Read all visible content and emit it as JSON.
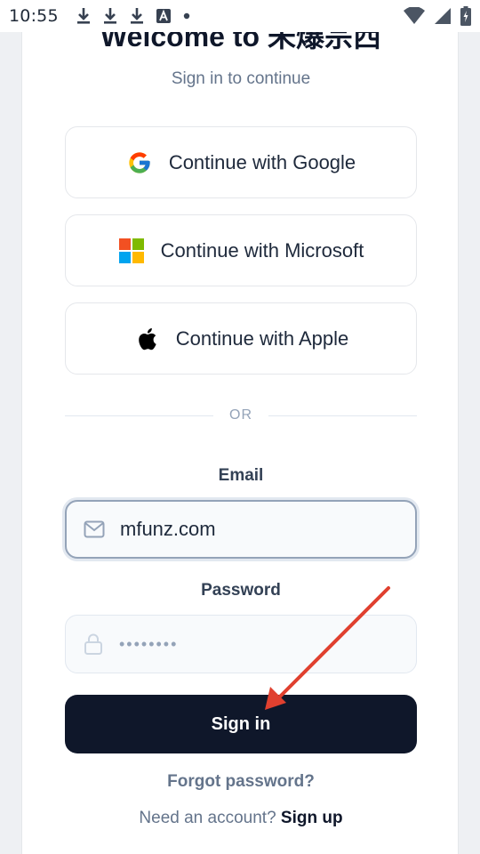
{
  "status_bar": {
    "time": "10:55",
    "left_icons": [
      "download-icon",
      "download-icon",
      "download-icon",
      "a-notification-icon",
      "dot-icon"
    ],
    "right_icons": [
      "wifi-icon",
      "signal-icon",
      "battery-charging-icon"
    ]
  },
  "card": {
    "title": "Welcome to 未爆宗西",
    "subtitle": "Sign in to continue"
  },
  "oauth": {
    "google": {
      "label": "Continue with Google",
      "icon": "google-icon"
    },
    "microsoft": {
      "label": "Continue with Microsoft",
      "icon": "microsoft-icon"
    },
    "apple": {
      "label": "Continue with Apple",
      "icon": "apple-icon"
    }
  },
  "divider": {
    "text": "OR"
  },
  "email": {
    "label": "Email",
    "value": "mfunz.com",
    "icon": "mail-icon"
  },
  "password": {
    "label": "Password",
    "value": "••••••••",
    "icon": "lock-icon"
  },
  "signin": {
    "label": "Sign in"
  },
  "forgot": {
    "label": "Forgot password?"
  },
  "signup": {
    "prompt": "Need an account?",
    "link": "Sign up"
  },
  "colors": {
    "primary_button": "#0f172a",
    "annotation_arrow": "#e0402f"
  }
}
